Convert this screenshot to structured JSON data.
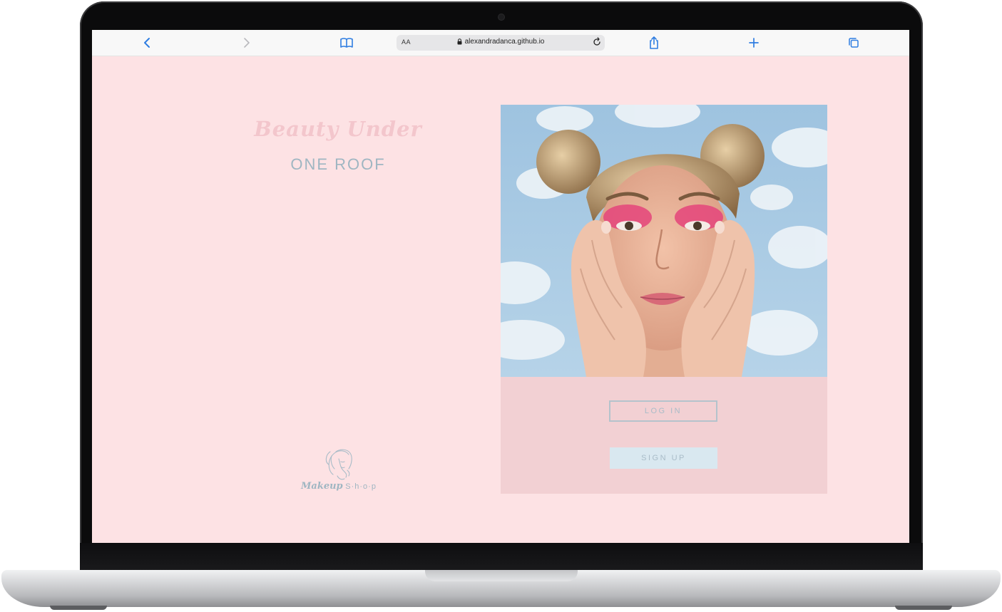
{
  "browser": {
    "text_size_label": "AA",
    "url": "alexandradanca.github.io",
    "icons": {
      "back": "chevron-left-icon",
      "forward": "chevron-right-icon",
      "bookmarks": "book-icon",
      "lock": "lock-icon",
      "reload": "reload-icon",
      "share": "share-icon",
      "new_tab": "plus-icon",
      "tabs": "tabs-icon"
    }
  },
  "page": {
    "title_script": "Beauty Under",
    "title_caps": "ONE ROOF",
    "logo": {
      "word_script": "Makeup",
      "word_spaced": "S·h·o·p"
    },
    "buttons": {
      "login": "LOG IN",
      "signup": "SIGN UP"
    },
    "colors": {
      "background": "#fde2e4",
      "card": "#f2d0d3",
      "accent_blue": "#9fb6c2",
      "signup_fill": "#d9e8f0",
      "title_pink": "#f3c6cc",
      "link_blue": "#2f7de1"
    }
  }
}
